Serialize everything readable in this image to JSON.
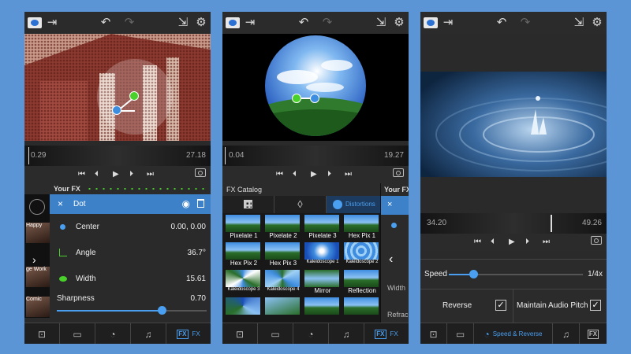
{
  "panel1": {
    "timeline": {
      "start": "0.29",
      "end": "27.18"
    },
    "your_fx_label": "Your FX",
    "effect": {
      "close": "×",
      "name": "Dot"
    },
    "params": [
      {
        "label": "Center",
        "value": "0.00, 0.00"
      },
      {
        "label": "Angle",
        "value": "36.7°"
      },
      {
        "label": "Width",
        "value": "15.61"
      }
    ],
    "sharpness": {
      "label": "Sharpness",
      "value": "0.70",
      "level": 0.7
    },
    "thumbs": [
      "Happy",
      "ge Work",
      "Comic"
    ],
    "fx_tab": "FX"
  },
  "panel2": {
    "timeline": {
      "start": "0.04",
      "end": "19.27"
    },
    "catalog_title": "FX Catalog",
    "side_title": "Your FX",
    "distortions_tab": "Distortions",
    "side_labels": [
      "Width",
      "Refrac"
    ],
    "effects": [
      "Pixelate 1",
      "Pixelate 2",
      "Pixelate 3",
      "Hex Pix 1",
      "Hex Pix 2",
      "Hex Pix 3",
      "Kaleidoscope 1",
      "Kaleidoscope 2",
      "Kaleidoscope 3",
      "Kaleidoscope 4",
      "Mirror",
      "Reflection"
    ],
    "fx_tab": "FX"
  },
  "panel3": {
    "timeline": {
      "start": "34.20",
      "end": "49.26"
    },
    "speed_label": "Speed",
    "speed_value": "1/4x",
    "speed_level": 0.18,
    "reverse_label": "Reverse",
    "audio_label": "Maintain Audio Pitch",
    "active_tab": "Speed & Reverse"
  },
  "transport": {
    "start": "⏮",
    "prev": "⏴",
    "play": "▶",
    "next": "⏵",
    "end": "⏭"
  },
  "colors": {
    "accent": "#4a9ff0",
    "background": "#5b95d6",
    "panel": "#2a2a2a"
  }
}
